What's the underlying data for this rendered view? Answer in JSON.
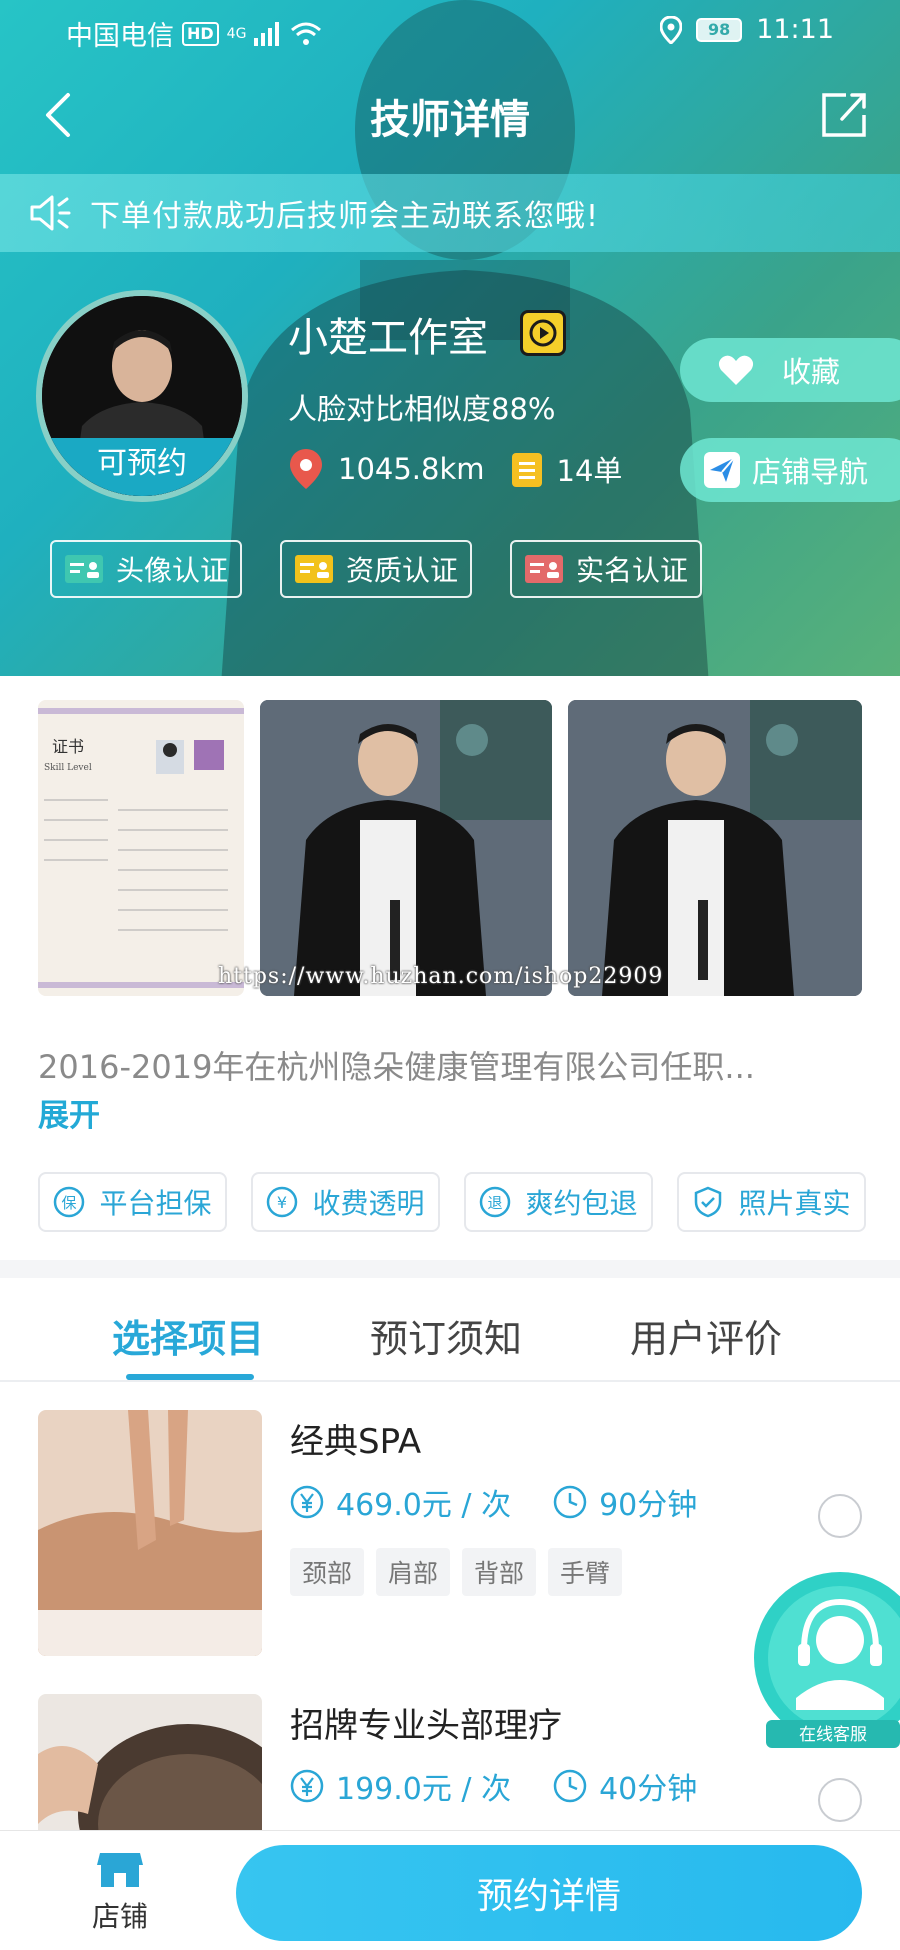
{
  "status_bar": {
    "carrier": "中国电信",
    "hd_badge": "HD",
    "network": "4G",
    "battery": "98",
    "time": "11:11"
  },
  "nav": {
    "title": "技师详情",
    "back_icon": "back-chevron-icon",
    "share_icon": "share-icon"
  },
  "notice": {
    "text": "下单付款成功后技师会主动联系您哦!",
    "icon": "speaker-icon"
  },
  "profile": {
    "avatar_status": "可预约",
    "studio_name": "小楚工作室",
    "similarity": "人脸对比相似度88%",
    "distance": "1045.8km",
    "orders": "14单",
    "favorite_label": "收藏",
    "navigate_label": "店铺导航"
  },
  "certifications": [
    {
      "label": "头像认证",
      "color": "#3fc7b0"
    },
    {
      "label": "资质认证",
      "color": "#f2c21b"
    },
    {
      "label": "实名认证",
      "color": "#e36a6a"
    }
  ],
  "gallery": {
    "watermark": "https://www.huzhan.com/ishop22909",
    "certificate_heading": "证书",
    "certificate_sub": "Skill Level"
  },
  "description": {
    "text": "2016-2019年在杭州隐朵健康管理有限公司任职...",
    "expand_label": "展开"
  },
  "guarantees": [
    {
      "label": "平台担保",
      "icon_char": "保"
    },
    {
      "label": "收费透明",
      "icon_char": "¥"
    },
    {
      "label": "爽约包退",
      "icon_char": "退"
    },
    {
      "label": "照片真实",
      "icon_char": "✓"
    }
  ],
  "tabs": [
    {
      "label": "选择项目",
      "active": true
    },
    {
      "label": "预订须知",
      "active": false
    },
    {
      "label": "用户评价",
      "active": false
    }
  ],
  "services": [
    {
      "name": "经典SPA",
      "price": "469.0元 / 次",
      "duration": "90分钟",
      "tags": [
        "颈部",
        "肩部",
        "背部",
        "手臂"
      ],
      "selected": false
    },
    {
      "name": "招牌专业头部理疗",
      "price": "199.0元 / 次",
      "duration": "40分钟",
      "tags": [],
      "selected": false
    }
  ],
  "customer_service": {
    "label": "在线客服"
  },
  "bottom_bar": {
    "shop_label": "店铺",
    "book_label": "预约详情"
  },
  "colors": {
    "accent": "#28a8d8",
    "hero_start": "#27c4c6",
    "hero_end": "#59b17a"
  }
}
